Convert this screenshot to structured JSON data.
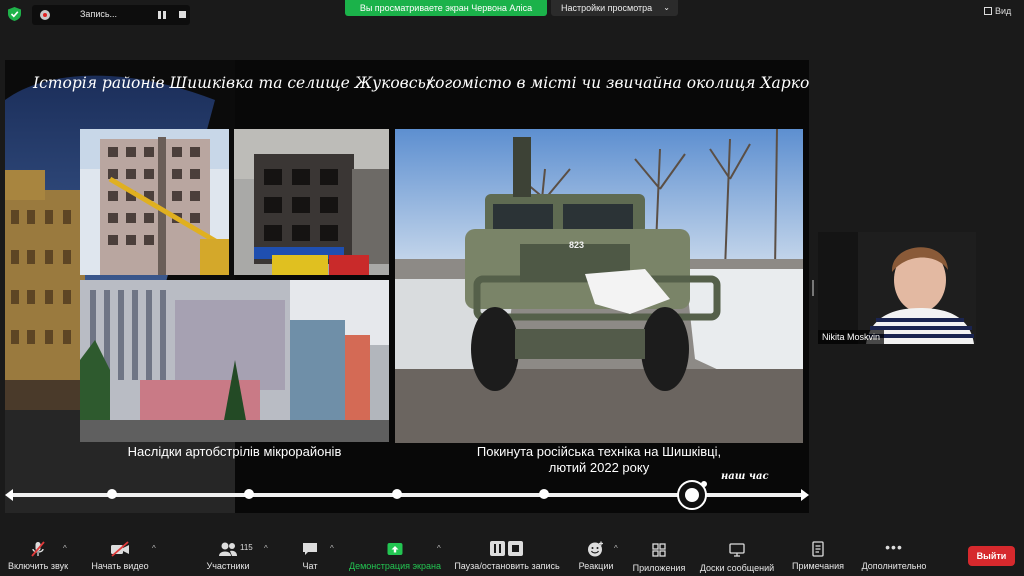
{
  "top_bar": {
    "recording_label": "Запись...",
    "viewing_banner": "Вы просматриваете экран Червона Аліса",
    "view_settings_label": "Настройки просмотра",
    "view_button_label": "Вид"
  },
  "slide": {
    "title_left": "Історія районів Шишківка та селище Жуковського",
    "title_separator": "/",
    "title_right": "місто в місті чи звичайна околиця Харкова?",
    "caption_left": "Наслідки артобстрілів мікрорайонів",
    "caption_right_line1": "Покинута російська техніка на Шишківці,",
    "caption_right_line2": "лютий 2022 року",
    "vehicle_plate": "823",
    "now_label": "наш час"
  },
  "participant": {
    "name": "Nikita Moskvin"
  },
  "toolbar": {
    "mute_label": "Включить звук",
    "video_label": "Начать видео",
    "participants_label": "Участники",
    "participants_count": "115",
    "chat_label": "Чат",
    "share_label": "Демонстрация экрана",
    "record_label": "Пауза/остановить запись",
    "reactions_label": "Реакции",
    "apps_label": "Приложения",
    "whiteboards_label": "Доски сообщений",
    "notes_label": "Примечания",
    "more_label": "Дополнительно",
    "leave_label": "Выйти"
  },
  "colors": {
    "share_green": "#23c552",
    "banner_green": "#1bb24a",
    "leave_red": "#d6292d"
  }
}
